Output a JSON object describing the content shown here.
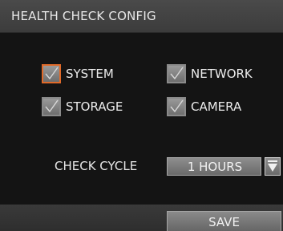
{
  "dialog": {
    "title": "HEALTH CHECK CONFIG"
  },
  "checks": {
    "system": {
      "label": "SYSTEM",
      "checked": true,
      "focused": true
    },
    "network": {
      "label": "NETWORK",
      "checked": true
    },
    "storage": {
      "label": "STORAGE",
      "checked": true
    },
    "camera": {
      "label": "CAMERA",
      "checked": true
    }
  },
  "cycle": {
    "label": "CHECK CYCLE",
    "value": "1 HOURS",
    "arrow_icon": "chevron-down-icon"
  },
  "actions": {
    "save_label": "SAVE"
  },
  "colors": {
    "focus": "#e06a2a",
    "background": "#141414",
    "title_bar": "#3c3c3c"
  }
}
